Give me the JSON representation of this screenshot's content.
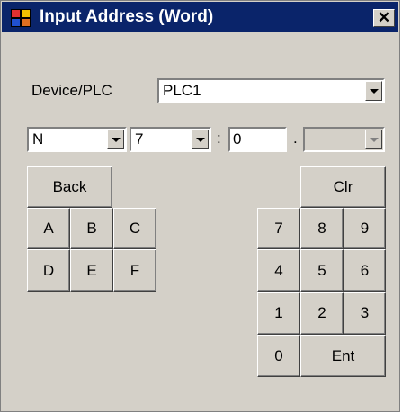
{
  "window": {
    "title": "Input Address (Word)",
    "close_label": "✕"
  },
  "device": {
    "label": "Device/PLC",
    "value": "PLC1"
  },
  "address": {
    "type_value": "N",
    "file_value": "7",
    "colon": ":",
    "element_value": "0",
    "dot": ".",
    "bit_value": ""
  },
  "keypad": {
    "back": "Back",
    "clr": "Clr",
    "a": "A",
    "b": "B",
    "c": "C",
    "d": "D",
    "e": "E",
    "f": "F",
    "n7": "7",
    "n8": "8",
    "n9": "9",
    "n4": "4",
    "n5": "5",
    "n6": "6",
    "n1": "1",
    "n2": "2",
    "n3": "3",
    "n0": "0",
    "ent": "Ent"
  },
  "colors": {
    "titlebar": "#0a246a",
    "face": "#d4d0c8"
  }
}
